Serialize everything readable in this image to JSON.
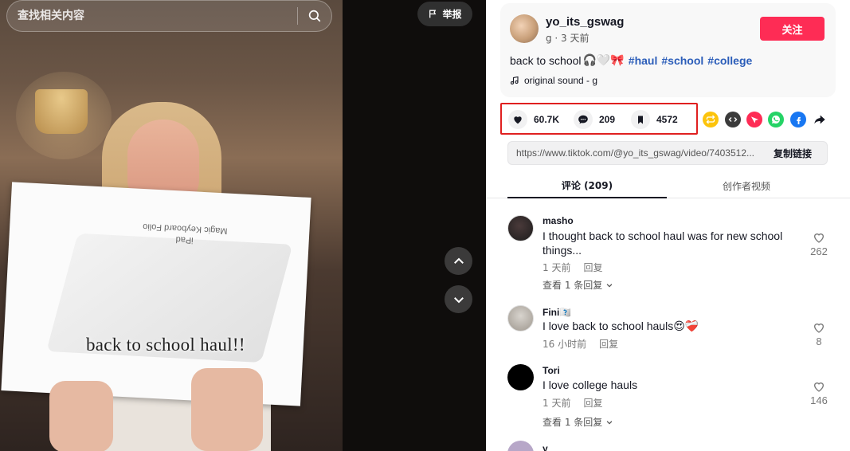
{
  "search": {
    "placeholder": "查找相关内容"
  },
  "video": {
    "caption": "back to school haul!!",
    "box_label_line1": "iPad",
    "box_label_line2": "Magic Keyboard Folio",
    "report_label": "举报"
  },
  "author": {
    "name": "yo_its_gswag",
    "sub": "g · 3 天前",
    "follow_label": "关注",
    "description": "back to school",
    "emojis": "🎧🤍🎀",
    "hashtags": [
      "#haul",
      "#school",
      "#college"
    ],
    "sound": "original sound - g"
  },
  "stats": {
    "likes": "60.7K",
    "comments": "209",
    "saves": "4572"
  },
  "share": {
    "icons": [
      "repost-icon",
      "embed-icon",
      "send-icon",
      "whatsapp-icon",
      "facebook-icon",
      "forward-icon"
    ],
    "colors": {
      "repost": "#fcc40c",
      "embed": "#3b3b3b",
      "send": "#fe2c55",
      "whatsapp": "#25d366",
      "facebook": "#1877f2",
      "forward": "#161823"
    }
  },
  "link": {
    "url": "https://www.tiktok.com/@yo_its_gswag/video/7403512...",
    "copy_label": "复制链接"
  },
  "tabs": {
    "comments": "评论 (209)",
    "creator_videos": "创作者视频"
  },
  "comments": [
    {
      "user": "masho",
      "text": "I thought back to school haul was for new school things...",
      "time": "1 天前",
      "reply": "回复",
      "likes": "262",
      "more": "查看 1 条回复"
    },
    {
      "user": "Fini🇽🇽",
      "text": "I love back to school hauls😍❤️‍🩹",
      "time": "16 小时前",
      "reply": "回复",
      "likes": "8"
    },
    {
      "user": "Tori",
      "text": "I love college hauls",
      "time": "1 天前",
      "reply": "回复",
      "likes": "146",
      "more": "查看 1 条回复"
    },
    {
      "user": "y"
    }
  ],
  "colors": {
    "accent": "#fe2c55",
    "hashtag": "#2b5db9",
    "highlight": "#e02020"
  }
}
